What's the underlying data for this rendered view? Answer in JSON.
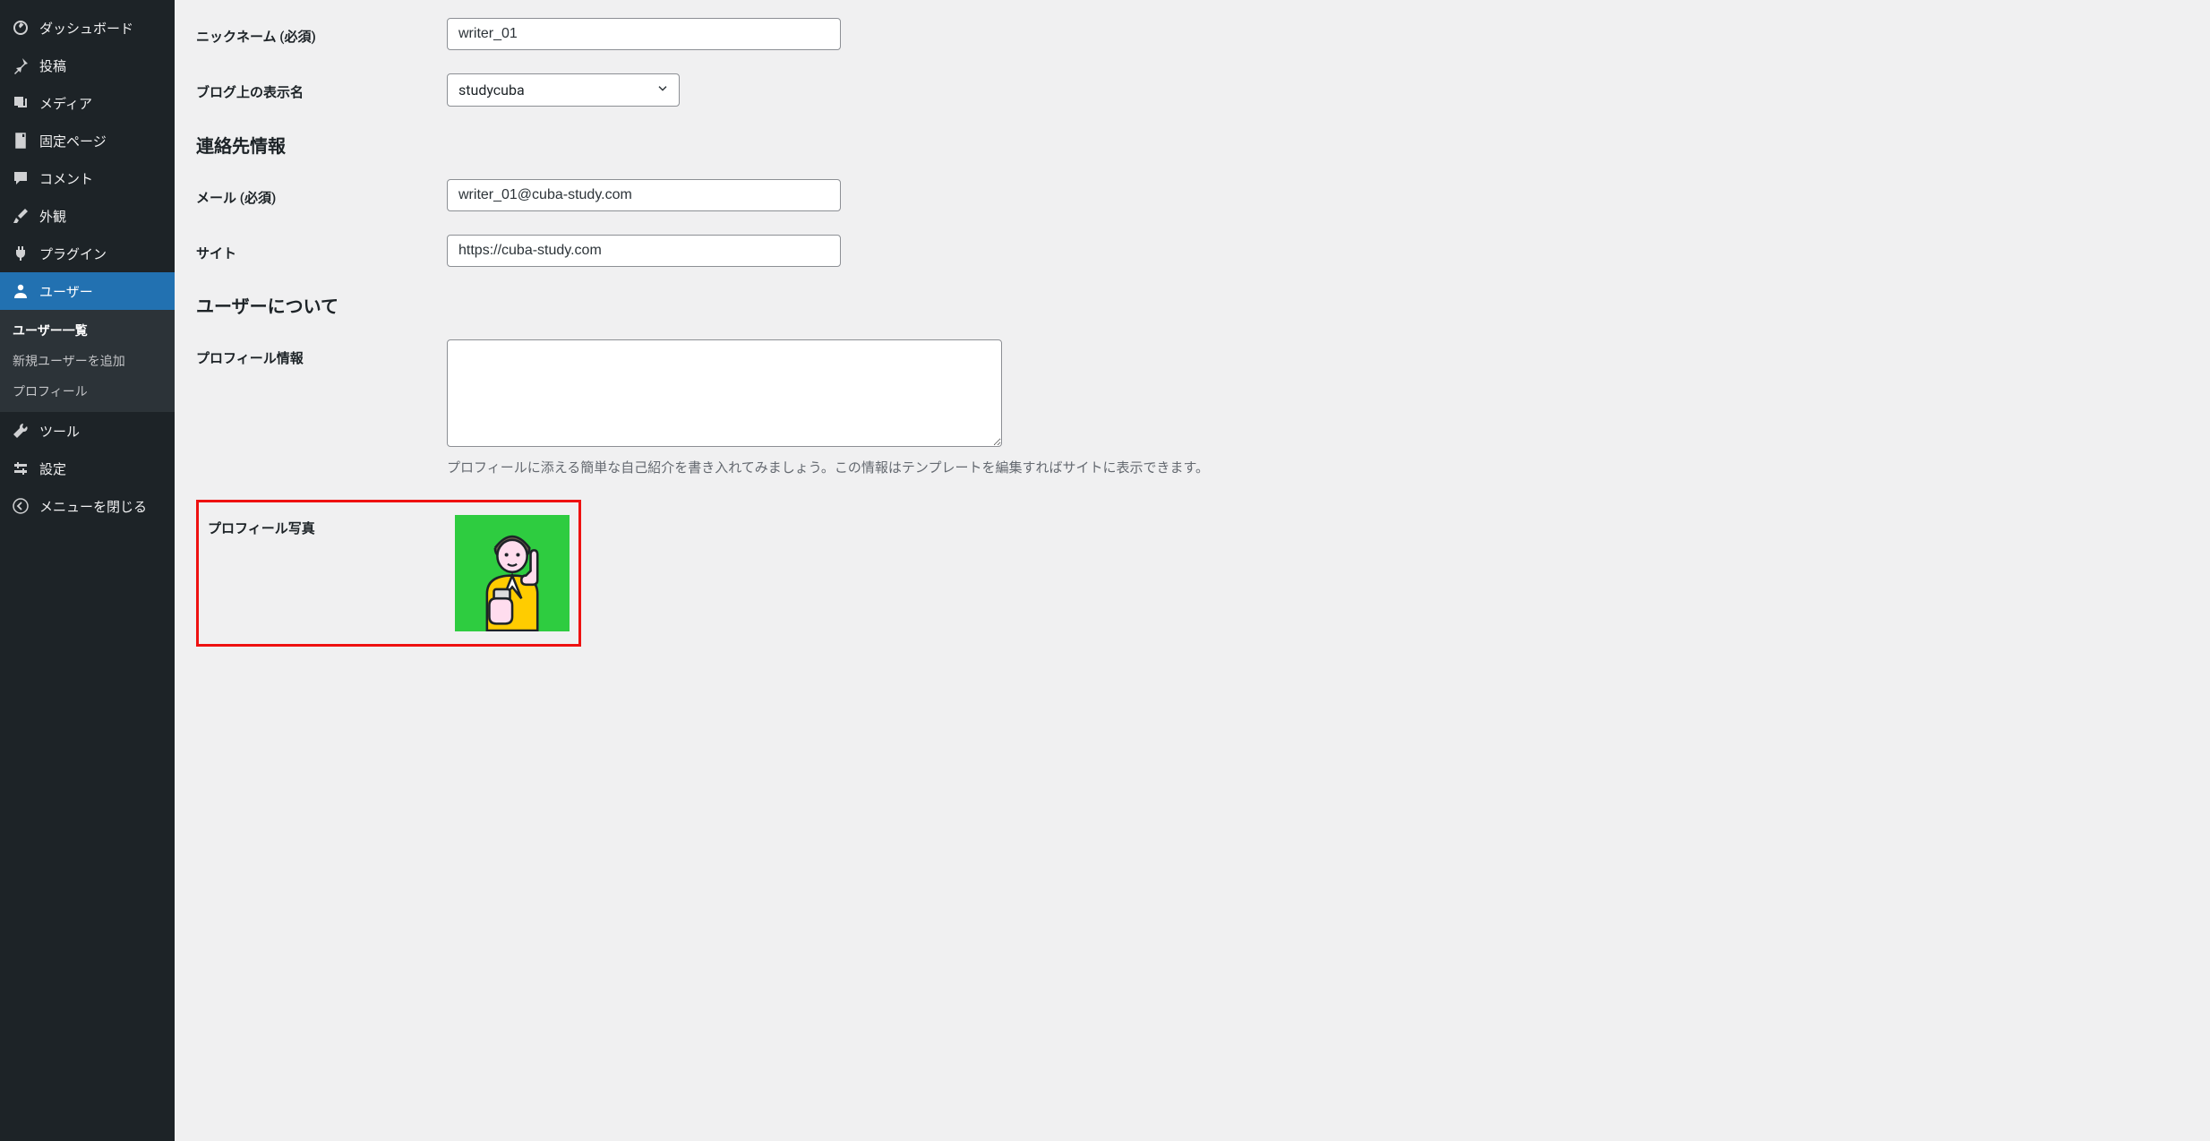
{
  "sidebar": {
    "dashboard": "ダッシュボード",
    "posts": "投稿",
    "media": "メディア",
    "pages": "固定ページ",
    "comments": "コメント",
    "appearance": "外観",
    "plugins": "プラグイン",
    "users": "ユーザー",
    "users_list": "ユーザー一覧",
    "users_new": "新規ユーザーを追加",
    "users_profile": "プロフィール",
    "tools": "ツール",
    "settings": "設定",
    "collapse": "メニューを閉じる"
  },
  "form": {
    "nickname_label": "ニックネーム (必須)",
    "nickname_value": "writer_01",
    "display_name_label": "ブログ上の表示名",
    "display_name_value": "studycuba",
    "contact_heading": "連絡先情報",
    "email_label": "メール (必須)",
    "email_value": "writer_01@cuba-study.com",
    "site_label": "サイト",
    "site_value": "https://cuba-study.com",
    "about_heading": "ユーザーについて",
    "bio_label": "プロフィール情報",
    "bio_value": "",
    "bio_help": "プロフィールに添える簡単な自己紹介を書き入れてみましょう。この情報はテンプレートを編集すればサイトに表示できます。",
    "avatar_label": "プロフィール写真"
  }
}
